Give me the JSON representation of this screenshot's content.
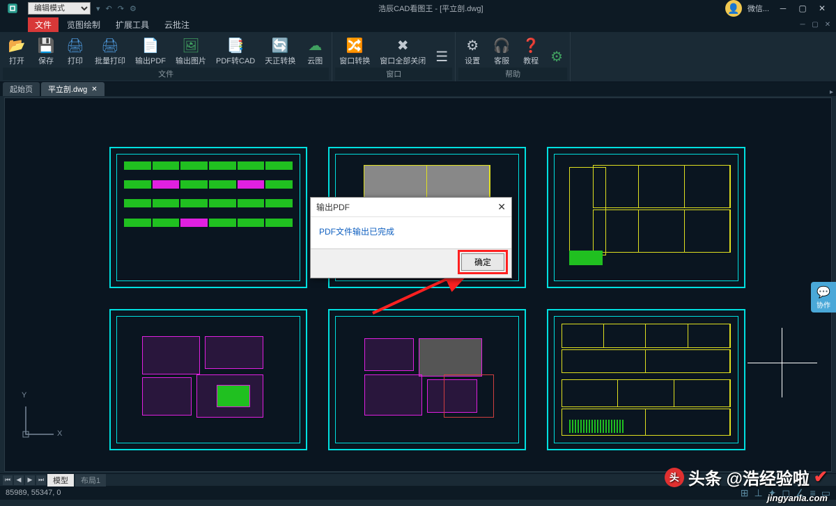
{
  "app": {
    "title": "浩辰CAD看图王 - [平立剖.dwg]",
    "mode": "编辑模式",
    "wechat": "微信..."
  },
  "menu": {
    "items": [
      "文件",
      "览图绘制",
      "扩展工具",
      "云批注"
    ]
  },
  "ribbon": {
    "groups": [
      {
        "label": "文件",
        "buttons": [
          {
            "icon": "📂",
            "label": "打开"
          },
          {
            "icon": "💾",
            "label": "保存"
          },
          {
            "icon": "🖨",
            "label": "打印"
          },
          {
            "icon": "🖨",
            "label": "批量打印"
          },
          {
            "icon": "📄",
            "label": "输出PDF"
          },
          {
            "icon": "🖼",
            "label": "输出图片"
          },
          {
            "icon": "📑",
            "label": "PDF转CAD"
          },
          {
            "icon": "🔄",
            "label": "天正转换"
          },
          {
            "icon": "☁",
            "label": "云图"
          }
        ]
      },
      {
        "label": "窗口",
        "buttons": [
          {
            "icon": "🔀",
            "label": "窗口转换"
          },
          {
            "icon": "✖",
            "label": "窗口全部关闭"
          },
          {
            "icon": "☰",
            "label": ""
          }
        ]
      },
      {
        "label": "帮助",
        "buttons": [
          {
            "icon": "⚙",
            "label": "设置"
          },
          {
            "icon": "🎧",
            "label": "客服"
          },
          {
            "icon": "❓",
            "label": "教程"
          },
          {
            "icon": "⚙",
            "label": ""
          }
        ]
      }
    ]
  },
  "tabs": {
    "start": "起始页",
    "file": "平立剖.dwg"
  },
  "dialog": {
    "title": "输出PDF",
    "message": "PDF文件输出已完成",
    "ok": "确定"
  },
  "collab": "协作",
  "layout_tabs": {
    "model": "模型",
    "layout1": "布局1"
  },
  "status": {
    "coords": "85989, 55347, 0"
  },
  "ucs": {
    "x": "X",
    "y": "Y"
  },
  "watermark": {
    "main": "头条 @浩经验啦",
    "site": "jingyanla.com"
  }
}
